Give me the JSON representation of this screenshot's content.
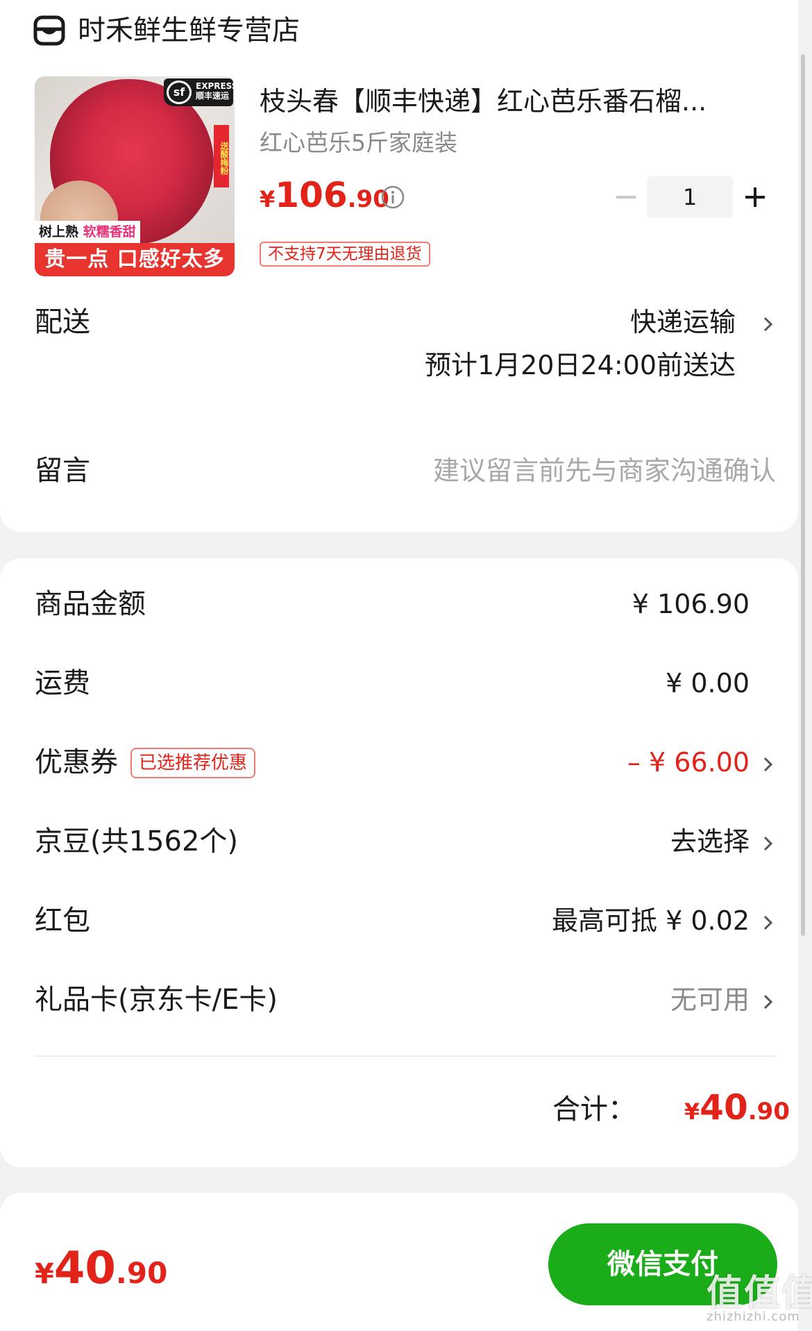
{
  "store": {
    "name": "时禾鲜生鲜专营店",
    "icon": "store-icon"
  },
  "product": {
    "title": "枝头春【顺丰快递】红心芭乐番石榴...",
    "spec": "红心芭乐5斤家庭装",
    "price": {
      "symbol": "¥",
      "integer": "106",
      "decimal": ".90"
    },
    "quantity": "1",
    "return_tag": "不支持7天无理由退货",
    "image": {
      "sf_badge": "EXPRESS\n顺丰速运",
      "sf_logo": "sf",
      "side_tag": "送酸梅粉",
      "tree_tag_black": "树上熟",
      "tree_tag_pink": "软糯香甜",
      "slogan": "贵一点 口感好太多"
    }
  },
  "delivery": {
    "label": "配送",
    "method": "快递运输",
    "eta": "预计1月20日24:00前送达"
  },
  "message": {
    "label": "留言",
    "placeholder": "建议留言前先与商家沟通确认"
  },
  "summary": {
    "goods_amount": {
      "label": "商品金额",
      "value": "¥ 106.90"
    },
    "shipping": {
      "label": "运费",
      "value": "¥ 0.00"
    },
    "coupon": {
      "label": "优惠券",
      "tag": "已选推荐优惠",
      "value": "– ¥ 66.00"
    },
    "jingdou": {
      "label": "京豆(共1562个)",
      "value": "去选择"
    },
    "redpacket": {
      "label": "红包",
      "value": "最高可抵 ¥ 0.02"
    },
    "giftcard": {
      "label": "礼品卡(京东卡/E卡)",
      "value": "无可用"
    },
    "total": {
      "label": "合计：",
      "symbol": "¥",
      "integer": "40",
      "decimal": ".90"
    }
  },
  "footer": {
    "price": {
      "symbol": "¥",
      "integer": "40",
      "decimal": ".90"
    },
    "pay_button": "微信支付"
  },
  "watermark": {
    "text": "值值值",
    "url": "zhizhizhi.com"
  },
  "colors": {
    "accent_red": "#e2231a",
    "pay_green": "#1aad19"
  }
}
